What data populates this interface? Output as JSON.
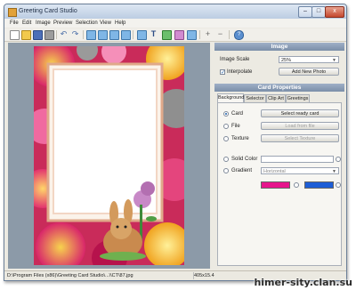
{
  "window": {
    "title": "Greeting Card Studio",
    "minimize_label": "–",
    "maximize_label": "□",
    "close_label": "x"
  },
  "menu": [
    "File",
    "Edit",
    "Image",
    "Preview",
    "Selection",
    "View",
    "Help"
  ],
  "toolbar": {
    "items": [
      "new-icon",
      "open-icon",
      "save-icon",
      "print-icon",
      "undo-icon",
      "redo-icon",
      "image-icon",
      "text-icon",
      "shape-icon",
      "clipart-icon",
      "zoom-in-icon",
      "zoom-out-icon",
      "help-icon"
    ],
    "text_glyph": "T",
    "undo_glyph": "↶",
    "redo_glyph": "↷",
    "zoomin_glyph": "+",
    "zoomout_glyph": "−",
    "help_glyph": "?"
  },
  "image_panel": {
    "header": "Image",
    "scale_label": "Image Scale",
    "scale_value": "25%",
    "interpolate_label": "Interpolate",
    "interpolate_checked": true,
    "add_photo_label": "Add New Photo"
  },
  "card_panel": {
    "header": "Card Properties",
    "tabs": [
      "Background",
      "Selector",
      "Clip Art",
      "Greetings"
    ],
    "active_tab": "Background",
    "options": {
      "card_label": "Card",
      "card_button": "Select ready card",
      "file_label": "File",
      "file_button": "Load from file",
      "texture_label": "Texture",
      "texture_button": "Select Texture",
      "solid_label": "Solid Color",
      "gradient_label": "Gradient",
      "gradient_value": "Horizontal"
    },
    "colors": {
      "gradient_start": "#e6168c",
      "gradient_end": "#1e5ed6"
    }
  },
  "status": {
    "path": "D:\\Program Files (x86)\\Greeting Card Studio\\...\\\\CT\\87.jpg",
    "size": "405x15.4"
  },
  "watermark": "himer-sity.clan.su"
}
